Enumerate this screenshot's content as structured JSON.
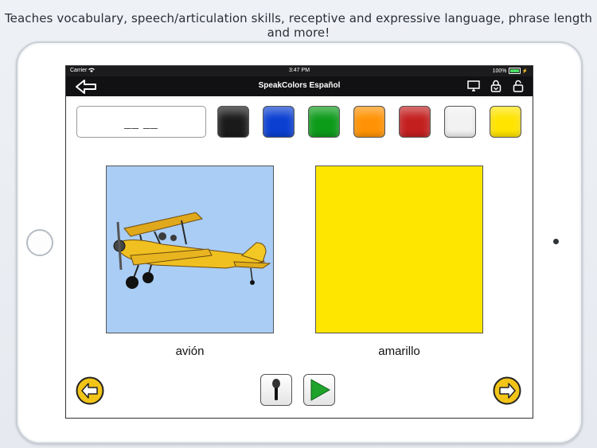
{
  "caption": "Teaches vocabulary, speech/articulation skills, receptive and expressive language, phrase length and more!",
  "status_bar": {
    "carrier": "Carrier",
    "time": "3:47 PM",
    "battery": "100%"
  },
  "nav": {
    "title": "SpeakColors Español",
    "back_icon": "back-arrow-icon",
    "icons": [
      "display-icon",
      "lock-down-icon",
      "lock-open-icon"
    ]
  },
  "answer": {
    "text": "__ __"
  },
  "swatches": [
    {
      "name": "black",
      "color": "#1a1a1a"
    },
    {
      "name": "blue",
      "color": "#0a3fd1"
    },
    {
      "name": "green",
      "color": "#0d9b1a"
    },
    {
      "name": "orange",
      "color": "#ff9305"
    },
    {
      "name": "red",
      "color": "#c41f1f"
    },
    {
      "name": "white",
      "color": "#f2f2f2"
    },
    {
      "name": "yellow",
      "color": "#ffe400"
    }
  ],
  "pictures": {
    "left_label": "avión",
    "right_label": "amarillo",
    "left_bg": "#a9cdf5",
    "right_color": "#ffe600"
  },
  "controls": {
    "prev_icon": "left-arrow-circle-icon",
    "next_icon": "right-arrow-circle-icon",
    "mic_icon": "microphone-icon",
    "play_icon": "play-icon",
    "accent": "#f2c418"
  }
}
